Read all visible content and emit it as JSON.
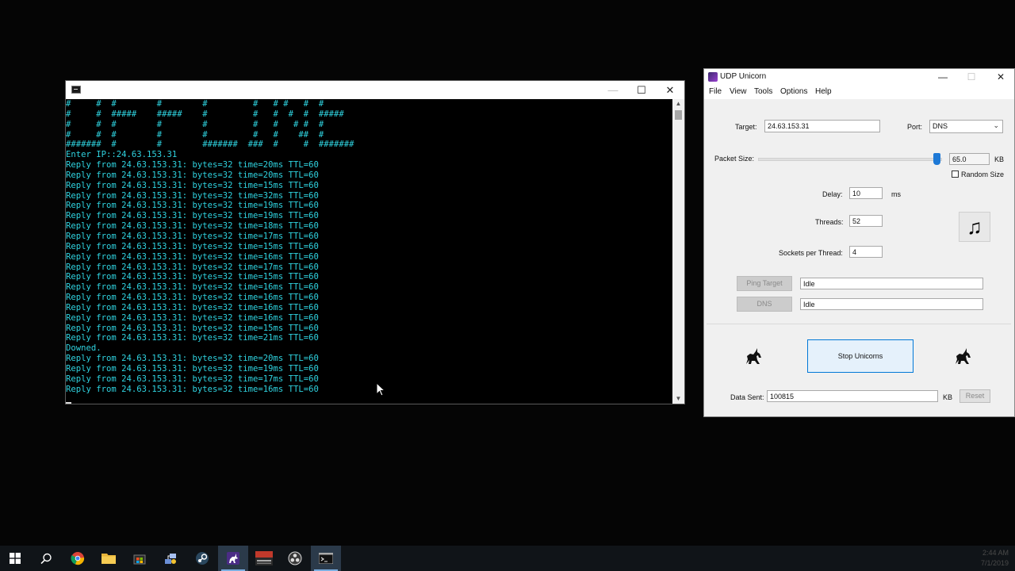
{
  "console": {
    "lines": [
      "#     #  #        #        #         #   # #   #  #",
      "#     #  #####    #####    #         #   #  #  #  #####",
      "#     #  #        #        #         #   #   # #  #",
      "#     #  #        #        #         #   #    ##  #",
      "#######  #        #        #######  ###  #     #  #######",
      "Enter IP::24.63.153.31",
      "Reply from 24.63.153.31: bytes=32 time=20ms TTL=60",
      "Reply from 24.63.153.31: bytes=32 time=20ms TTL=60",
      "Reply from 24.63.153.31: bytes=32 time=15ms TTL=60",
      "Reply from 24.63.153.31: bytes=32 time=32ms TTL=60",
      "Reply from 24.63.153.31: bytes=32 time=19ms TTL=60",
      "Reply from 24.63.153.31: bytes=32 time=19ms TTL=60",
      "Reply from 24.63.153.31: bytes=32 time=18ms TTL=60",
      "Reply from 24.63.153.31: bytes=32 time=17ms TTL=60",
      "Reply from 24.63.153.31: bytes=32 time=15ms TTL=60",
      "Reply from 24.63.153.31: bytes=32 time=16ms TTL=60",
      "Reply from 24.63.153.31: bytes=32 time=17ms TTL=60",
      "Reply from 24.63.153.31: bytes=32 time=15ms TTL=60",
      "Reply from 24.63.153.31: bytes=32 time=16ms TTL=60",
      "Reply from 24.63.153.31: bytes=32 time=16ms TTL=60",
      "Reply from 24.63.153.31: bytes=32 time=16ms TTL=60",
      "Reply from 24.63.153.31: bytes=32 time=16ms TTL=60",
      "Reply from 24.63.153.31: bytes=32 time=15ms TTL=60",
      "Reply from 24.63.153.31: bytes=32 time=21ms TTL=60",
      "Downed.",
      "Reply from 24.63.153.31: bytes=32 time=20ms TTL=60",
      "Reply from 24.63.153.31: bytes=32 time=19ms TTL=60",
      "Reply from 24.63.153.31: bytes=32 time=17ms TTL=60",
      "Reply from 24.63.153.31: bytes=32 time=16ms TTL=60"
    ],
    "minimize_glyph": "—",
    "maximize_glyph": "☐",
    "close_glyph": "✕",
    "scroll_up_glyph": "▲",
    "scroll_down_glyph": "▼"
  },
  "unicorn": {
    "title": "UDP Unicorn",
    "window_controls": {
      "minimize": "—",
      "maximize": "☐",
      "close": "✕"
    },
    "menu": [
      "File",
      "View",
      "Tools",
      "Options",
      "Help"
    ],
    "target_label": "Target:",
    "target_value": "24.63.153.31",
    "port_label": "Port:",
    "port_value": "DNS",
    "packet_size_label": "Packet Size:",
    "packet_size_value": "65.0",
    "packet_size_unit": "KB",
    "packet_size_slider": 0.98,
    "random_size_label": "Random Size",
    "random_size_checked": false,
    "delay_label": "Delay:",
    "delay_value": "10",
    "delay_unit": "ms",
    "threads_label": "Threads:",
    "threads_value": "52",
    "sockets_label": "Sockets per Thread:",
    "sockets_value": "4",
    "ping_button": "Ping Target",
    "ping_status": "Idle",
    "dns_button": "DNS",
    "dns_status": "Idle",
    "stop_button": "Stop Unicorns",
    "data_sent_label": "Data Sent:",
    "data_sent_value": "100815",
    "data_sent_unit": "KB",
    "reset_button": "Reset",
    "icons": {
      "music": "music-note-icon",
      "unicorn": "unicorn-icon",
      "chevron": "chevron-down-icon"
    },
    "chevron_glyph": "⌄",
    "music_glyph": "♫"
  },
  "taskbar": {
    "items": [
      "windows-start",
      "search",
      "chrome",
      "file-explorer",
      "store",
      "network-tool",
      "steam",
      "udp-unicorn",
      "voicemeeter",
      "obs",
      "command-prompt"
    ],
    "clock_time": "2:44 AM",
    "clock_date": "7/1/2019"
  },
  "colors": {
    "console_text": "#2fd3e0",
    "accent": "#0078d7",
    "slider": "#1e79d6"
  }
}
